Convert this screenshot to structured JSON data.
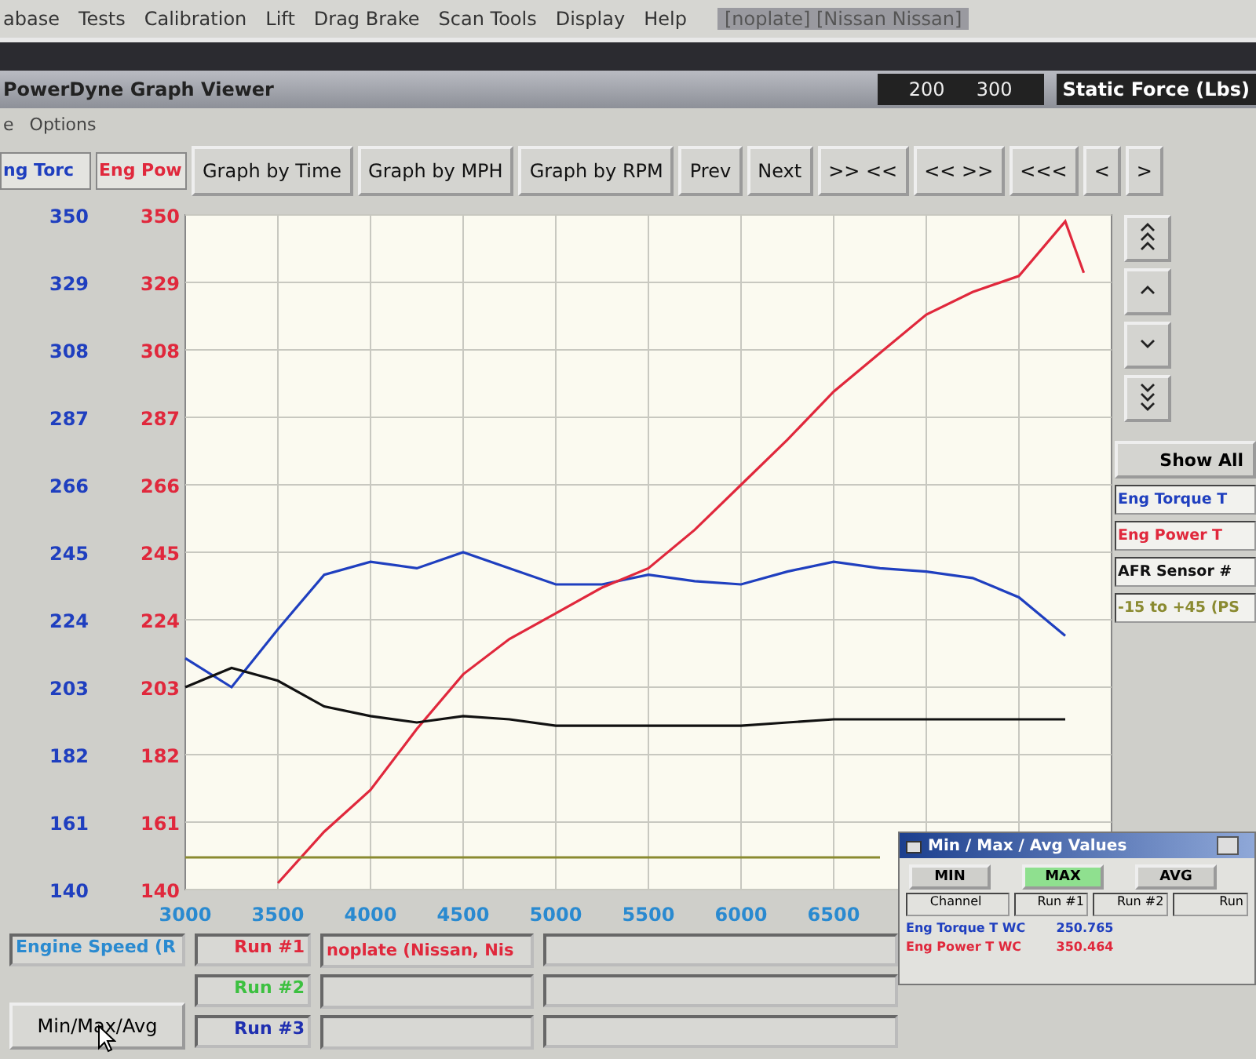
{
  "app_title": "[noplate] [Nissan Nissan]",
  "menu": [
    "abase",
    "Tests",
    "Calibration",
    "Lift",
    "Drag Brake",
    "Scan Tools",
    "Display",
    "Help"
  ],
  "viewer": {
    "title": "PowerDyne Graph Viewer",
    "range_low": "200",
    "range_high": "300",
    "static_label": "Static Force (Lbs)"
  },
  "viewer_menu": [
    "e",
    "Options"
  ],
  "axis_headers": [
    {
      "label": "ng Torc",
      "color": "#1f3fbf"
    },
    {
      "label": "Eng Pow",
      "color": "#e0283c"
    }
  ],
  "toolbar": [
    "Graph by Time",
    "Graph by MPH",
    "Graph by RPM",
    "Prev",
    "Next",
    ">> <<",
    "<< >>",
    "<<<",
    "<",
    ">"
  ],
  "side_panel": {
    "show_all": "Show All"
  },
  "torque_axis": [
    "350",
    "329",
    "308",
    "287",
    "266",
    "245",
    "224",
    "203",
    "182",
    "161",
    "140"
  ],
  "chart_data": {
    "type": "line",
    "x": [
      3000,
      3250,
      3500,
      3750,
      4000,
      4250,
      4500,
      4750,
      5000,
      5250,
      5500,
      5750,
      6000,
      6250,
      6500,
      6750,
      7000,
      7250,
      7500,
      7750,
      7850
    ],
    "series": [
      {
        "name": "Eng Torque T",
        "color": "#1f3fbf",
        "values": [
          212,
          203,
          221,
          238,
          242,
          240,
          245,
          240,
          235,
          235,
          238,
          236,
          235,
          239,
          242,
          240,
          239,
          237,
          231,
          219,
          null
        ]
      },
      {
        "name": "Eng Power T",
        "color": "#e0283c",
        "values": [
          null,
          null,
          142,
          158,
          171,
          190,
          207,
          218,
          226,
          234,
          240,
          252,
          266,
          280,
          295,
          307,
          319,
          326,
          331,
          348,
          332
        ]
      },
      {
        "name": "AFR Sensor #",
        "color": "#111111",
        "values": [
          203,
          209,
          205,
          197,
          194,
          192,
          194,
          193,
          191,
          191,
          191,
          191,
          191,
          192,
          193,
          193,
          193,
          193,
          193,
          193,
          null
        ]
      },
      {
        "name": "-15 to +45 (PS",
        "color": "#8a8a30",
        "values": [
          150,
          150,
          150,
          150,
          150,
          150,
          150,
          150,
          150,
          150,
          150,
          150,
          150,
          150,
          150,
          150,
          null,
          null,
          null,
          null,
          null
        ]
      }
    ],
    "grid": true,
    "xlim": [
      3000,
      8000
    ],
    "ylim": [
      140,
      350
    ],
    "xticks": [
      3000,
      3500,
      4000,
      4500,
      5000,
      5500,
      6000,
      6500
    ],
    "yticks": [
      140,
      161,
      182,
      203,
      224,
      245,
      266,
      287,
      308,
      329,
      350
    ]
  },
  "bottom": {
    "x_channel": "Engine Speed (R",
    "runs": [
      {
        "label": "Run #1",
        "color": "#e0283c",
        "vehicle": "noplate (Nissan, Nis"
      },
      {
        "label": "Run #2",
        "color": "#3cc040"
      },
      {
        "label": "Run #3",
        "color": "#1f2fb0"
      }
    ],
    "minmax_button": "Min/Max/Avg"
  },
  "popup": {
    "title": "Min / Max / Avg Values",
    "modes": [
      {
        "label": "MIN",
        "selected": false
      },
      {
        "label": "MAX",
        "selected": true
      },
      {
        "label": "AVG",
        "selected": false
      }
    ],
    "columns": [
      "Channel",
      "Run #1",
      "Run #2",
      "Run"
    ],
    "rows": [
      {
        "channel": "Eng Torque T WC",
        "run_1": "250.765",
        "color": "#1f3fbf"
      },
      {
        "channel": "Eng Power T WC",
        "run_1": "350.464",
        "color": "#e0283c"
      }
    ]
  }
}
